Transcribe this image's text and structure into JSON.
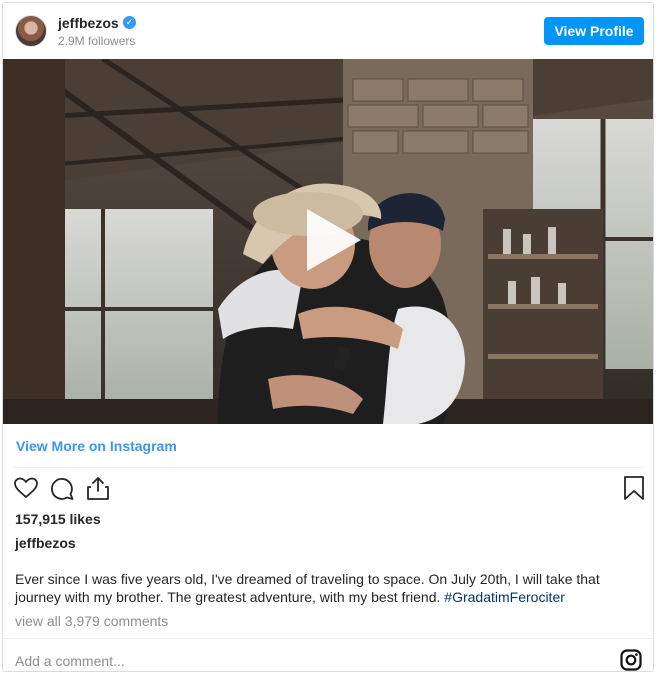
{
  "header": {
    "username": "jeffbezos",
    "followers": "2.9M followers",
    "view_profile_label": "View Profile",
    "verified_glyph": "✓"
  },
  "media": {
    "type": "video",
    "play_icon": "play-icon"
  },
  "view_more_label": "View More on Instagram",
  "actions": {
    "icons": [
      "heart-icon",
      "comment-icon",
      "share-icon",
      "bookmark-icon"
    ]
  },
  "likes": "157,915 likes",
  "owner": "jeffbezos",
  "caption": {
    "text": "Ever since I was five years old, I've dreamed of traveling to space. On July 20th, I will take that journey with my brother. The greatest adventure, with my best friend. ",
    "hashtag": "#GradatimFerociter"
  },
  "comments_link": "view all 3,979 comments",
  "add_comment_placeholder": "Add a comment...",
  "colors": {
    "accent": "#0095f6",
    "link": "#3897f0",
    "hashtag": "#00376b",
    "muted": "#8e8e8e"
  }
}
